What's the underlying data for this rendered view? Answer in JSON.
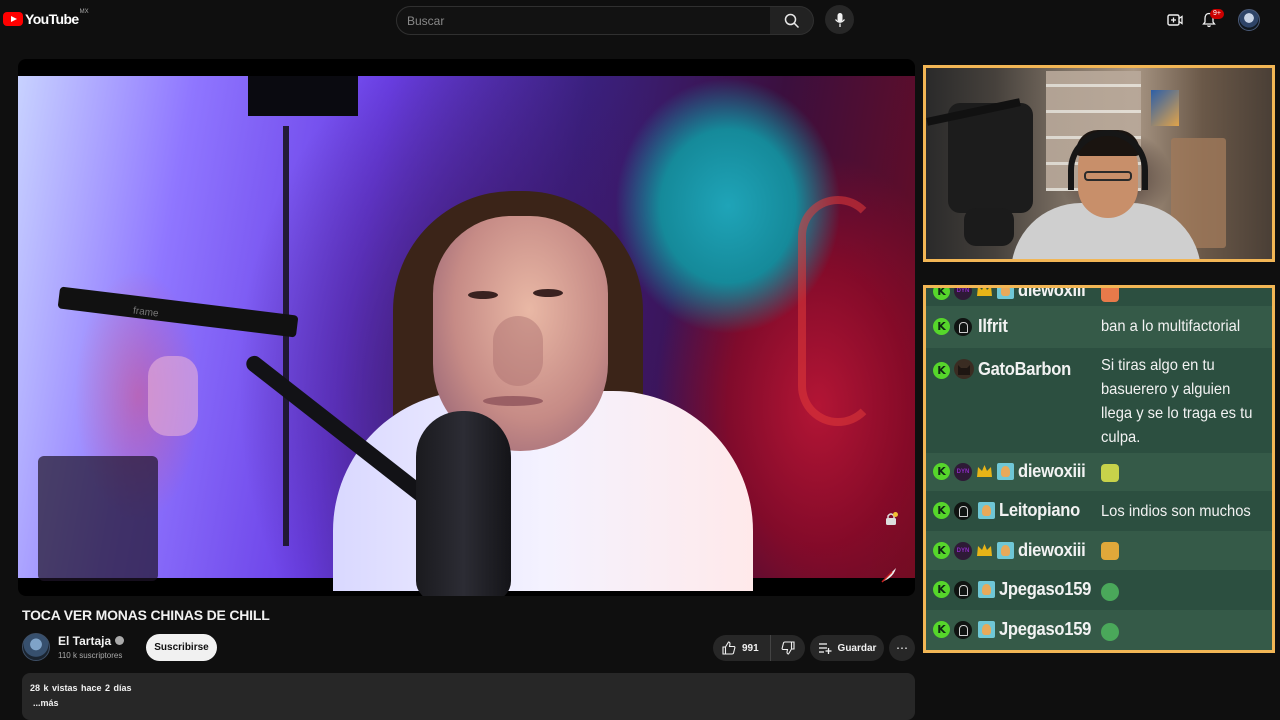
{
  "header": {
    "logo_text": "YouTube",
    "logo_country": "MX",
    "search_placeholder": "Buscar",
    "notification_count": "9+",
    "icons": [
      "search-icon",
      "mic-icon",
      "create-icon",
      "bell-icon",
      "avatar"
    ]
  },
  "video": {
    "title": "TOCA VER MONAS CHINAS DE CHILL",
    "boom_label": "frame"
  },
  "channel": {
    "name": "El Tartaja",
    "subscribers": "110 k suscriptores",
    "subscribe_label": "Suscribirse"
  },
  "actions": {
    "like_count": "991",
    "save_label": "Guardar",
    "more_label": "⋯"
  },
  "description": {
    "meta": "28 k vistas  hace 2 días",
    "more": "...más"
  },
  "colors": {
    "frame_border": "#f2b655",
    "chat_bg": "#2c4f40",
    "badge_green": "#56d62b",
    "subscribe_bg": "#f1f1f1"
  },
  "chat": {
    "messages": [
      {
        "user": "diewoxiii",
        "message": ""
      },
      {
        "user": "Ilfrit",
        "message": "ban a lo multifactorial"
      },
      {
        "user": "GatoBarbon",
        "message": "Si tiras algo en tu basuerero y alguien llega y se lo traga es tu culpa."
      },
      {
        "user": "diewoxiii",
        "message": ""
      },
      {
        "user": "Leitopiano",
        "message": "Los indios son muchos"
      },
      {
        "user": "diewoxiii",
        "message": ""
      },
      {
        "user": "Jpegaso159",
        "message": ""
      },
      {
        "user": "Jpegaso159",
        "message": ""
      }
    ],
    "k_label": "K",
    "dim_label": "DYN"
  }
}
